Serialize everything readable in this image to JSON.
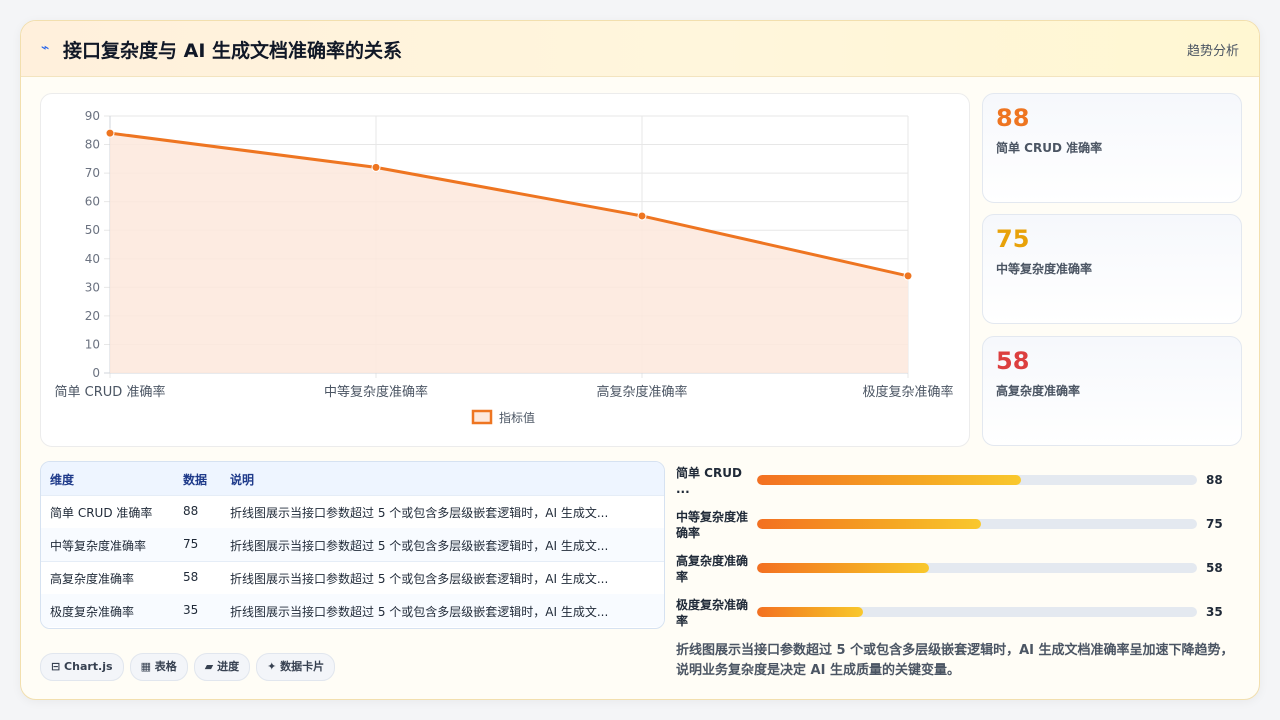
{
  "header": {
    "title": "接口复杂度与 AI 生成文档准确率的关系",
    "tag": "趋势分析"
  },
  "chart_data": {
    "type": "area",
    "categories": [
      "简单 CRUD 准确率",
      "中等复杂度准确率",
      "高复杂度准确率",
      "极度复杂准确率"
    ],
    "series": [
      {
        "name": "指标值",
        "values": [
          84,
          72,
          55,
          34
        ]
      }
    ],
    "ylim": [
      0,
      90
    ],
    "yticks": [
      0,
      10,
      20,
      30,
      40,
      50,
      60,
      70,
      80,
      90
    ],
    "legend_position": "bottom",
    "grid": true,
    "colors": {
      "line": "#ee7521",
      "fill": "#fde8dc"
    }
  },
  "stats": [
    {
      "value": "88",
      "label": "简单 CRUD 准确率",
      "color": "#ee7521"
    },
    {
      "value": "75",
      "label": "中等复杂度准确率",
      "color": "#e8a20a"
    },
    {
      "value": "58",
      "label": "高复杂度准确率",
      "color": "#dc3f3f"
    }
  ],
  "table": {
    "headers": [
      "维度",
      "数据",
      "说明"
    ],
    "rows": [
      [
        "简单 CRUD 准确率",
        "88",
        "折线图展示当接口参数超过 5 个或包含多层级嵌套逻辑时，AI 生成文..."
      ],
      [
        "中等复杂度准确率",
        "75",
        "折线图展示当接口参数超过 5 个或包含多层级嵌套逻辑时，AI 生成文..."
      ],
      [
        "高复杂度准确率",
        "58",
        "折线图展示当接口参数超过 5 个或包含多层级嵌套逻辑时，AI 生成文..."
      ],
      [
        "极度复杂准确率",
        "35",
        "折线图展示当接口参数超过 5 个或包含多层级嵌套逻辑时，AI 生成文..."
      ]
    ]
  },
  "bars": [
    {
      "label": "简单 CRUD ...",
      "value": 88,
      "fraction": 0.6,
      "display": "88"
    },
    {
      "label": "中等复杂度准确率",
      "value": 75,
      "fraction": 0.51,
      "display": "75"
    },
    {
      "label": "高复杂度准确率",
      "value": 58,
      "fraction": 0.39,
      "display": "58"
    },
    {
      "label": "极度复杂准确率",
      "value": 35,
      "fraction": 0.24,
      "display": "35"
    }
  ],
  "pills": [
    "⊟ Chart.js",
    "▦ 表格",
    "▰ 进度",
    "✦ 数据卡片"
  ],
  "summary": "折线图展示当接口参数超过 5 个或包含多层级嵌套逻辑时，AI 生成文档准确率呈加速下降趋势，说明业务复杂度是决定 AI 生成质量的关键变量。"
}
